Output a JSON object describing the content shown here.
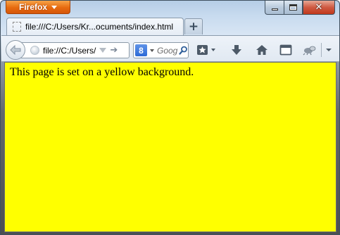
{
  "app": {
    "menu_button_label": "Firefox"
  },
  "tab": {
    "title": "file:///C:/Users/Kr...ocuments/index.html",
    "new_tab_label": "+"
  },
  "address_bar": {
    "url": "file://C:/Users/"
  },
  "search_bar": {
    "engine_letter": "8",
    "placeholder": "Goog"
  },
  "window_controls": {
    "close_glyph": "✕"
  },
  "page": {
    "background_color": "#ffff00",
    "text": "This page is set on a yellow background."
  },
  "icons": {
    "back": "back-arrow-icon",
    "globe": "globe-icon",
    "go": "go-arrow-icon",
    "search": "magnifier-icon",
    "bookmarks": "bookmark-star-icon",
    "downloads": "download-arrow-icon",
    "home": "home-icon",
    "window": "window-icon",
    "addon": "addon-icon",
    "menu": "chevron-down-icon"
  }
}
